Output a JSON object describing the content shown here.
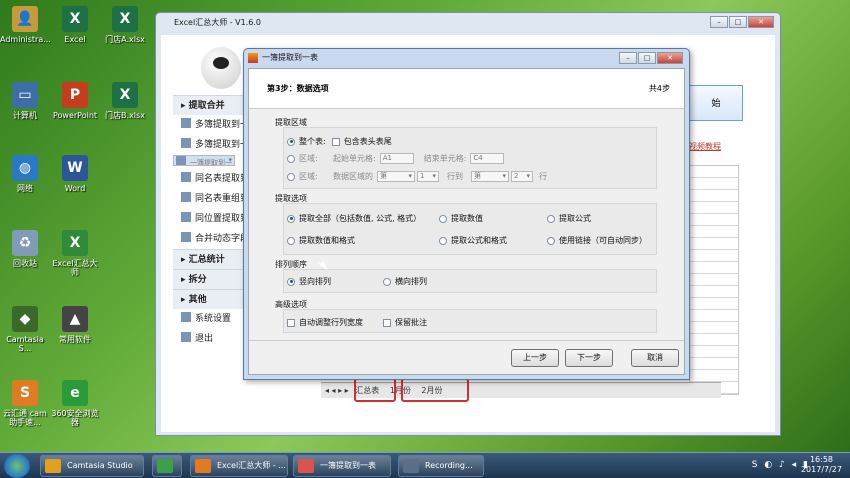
{
  "desktop": {
    "icons": [
      {
        "label": "Administra...",
        "glyph": "👤",
        "color": "#c79a3a"
      },
      {
        "label": "Excel",
        "glyph": "X",
        "color": "#1e7145"
      },
      {
        "label": "门店A.xlsx",
        "glyph": "X",
        "color": "#1e7145"
      },
      {
        "label": "计算机",
        "glyph": "▭",
        "color": "#3d6fa6"
      },
      {
        "label": "PowerPoint",
        "glyph": "P",
        "color": "#c43e1c"
      },
      {
        "label": "门店B.xlsx",
        "glyph": "X",
        "color": "#1e7145"
      },
      {
        "label": "网络",
        "glyph": "◍",
        "color": "#2b78c5"
      },
      {
        "label": "Word",
        "glyph": "W",
        "color": "#2b579a"
      },
      {
        "label": "回收站",
        "glyph": "♻",
        "color": "#7f9bb5"
      },
      {
        "label": "Excel汇总大师",
        "glyph": "X",
        "color": "#2f8a3a"
      },
      {
        "label": "Camtasia S...",
        "glyph": "◆",
        "color": "#3a6a2a"
      },
      {
        "label": "常用软件",
        "glyph": "▲",
        "color": "#444"
      },
      {
        "label": "云汇通 cam 助手速...",
        "glyph": "S",
        "color": "#e07b24"
      },
      {
        "label": "360安全浏览器",
        "glyph": "e",
        "color": "#2a9a3a"
      }
    ]
  },
  "main_window": {
    "title": "Excel汇总大师 - V1.6.0",
    "nav": [
      {
        "type": "head",
        "label": "▸ 提取合并"
      },
      {
        "type": "item",
        "label": "多簿提取到一"
      },
      {
        "type": "item",
        "label": "多簿提取到一"
      },
      {
        "type": "item",
        "label": "一簿提取到一",
        "selected": true
      },
      {
        "type": "item",
        "label": "同名表提取到"
      },
      {
        "type": "item",
        "label": "同名表重组到"
      },
      {
        "type": "item",
        "label": "同位置提取到"
      },
      {
        "type": "item",
        "label": "合并动态字段"
      },
      {
        "type": "head",
        "label": "▸ 汇总统计"
      },
      {
        "type": "head",
        "label": "▸ 拆分"
      },
      {
        "type": "head",
        "label": "▸ 其他"
      },
      {
        "type": "item",
        "label": "系统设置"
      },
      {
        "type": "item",
        "label": "退出"
      }
    ],
    "right_button": "始",
    "right_link": "视频教程",
    "sheet_tabs": [
      "汇总表",
      "1月份",
      "2月份"
    ],
    "row_number": "18"
  },
  "dialog": {
    "title": "一簿提取到一表",
    "step_title": "第3步：数据选项",
    "step_total": "共4步",
    "section_extract_area": "提取区域",
    "opt_whole_table": "整个表:",
    "opt_include_header": "包含表头表尾",
    "opt_range": "区域:",
    "label_start_cell": "起始单元格:",
    "start_cell_value": "A1",
    "label_end_cell": "结束单元格:",
    "end_cell_value": "C4",
    "opt_range2": "区域:",
    "label_data_area": "数据区域的",
    "sel_first": "第",
    "sel_num1": "1",
    "label_row_to": "行到",
    "sel_second": "第",
    "sel_num2": "2",
    "label_row": "行",
    "section_extract_options": "提取选项",
    "opt_extract_all": "提取全部（包括数值, 公式, 格式）",
    "opt_extract_values": "提取数值",
    "opt_extract_formula": "提取公式",
    "opt_values_format": "提取数值和格式",
    "opt_formula_format": "提取公式和格式",
    "opt_use_link": "使用链接（可自动同步）",
    "section_order": "排列顺序",
    "opt_vertical": "竖向排列",
    "opt_horizontal": "横向排列",
    "section_advanced": "高级选项",
    "opt_auto_width": "自动调整行列宽度",
    "opt_keep_comments": "保留批注",
    "btn_prev": "上一步",
    "btn_next": "下一步",
    "btn_cancel": "取消"
  },
  "taskbar": {
    "items": [
      {
        "label": "Camtasia Studio",
        "color": "#e0a020"
      },
      {
        "label": "",
        "color": "#3aa14a"
      },
      {
        "label": "Excel汇总大师 - ...",
        "color": "#e27a24"
      },
      {
        "label": "一簿提取到一表",
        "color": "#d9534f"
      },
      {
        "label": "Recording...",
        "color": "#5b6f86"
      }
    ],
    "time": "16:58",
    "date": "2017/7/27"
  }
}
